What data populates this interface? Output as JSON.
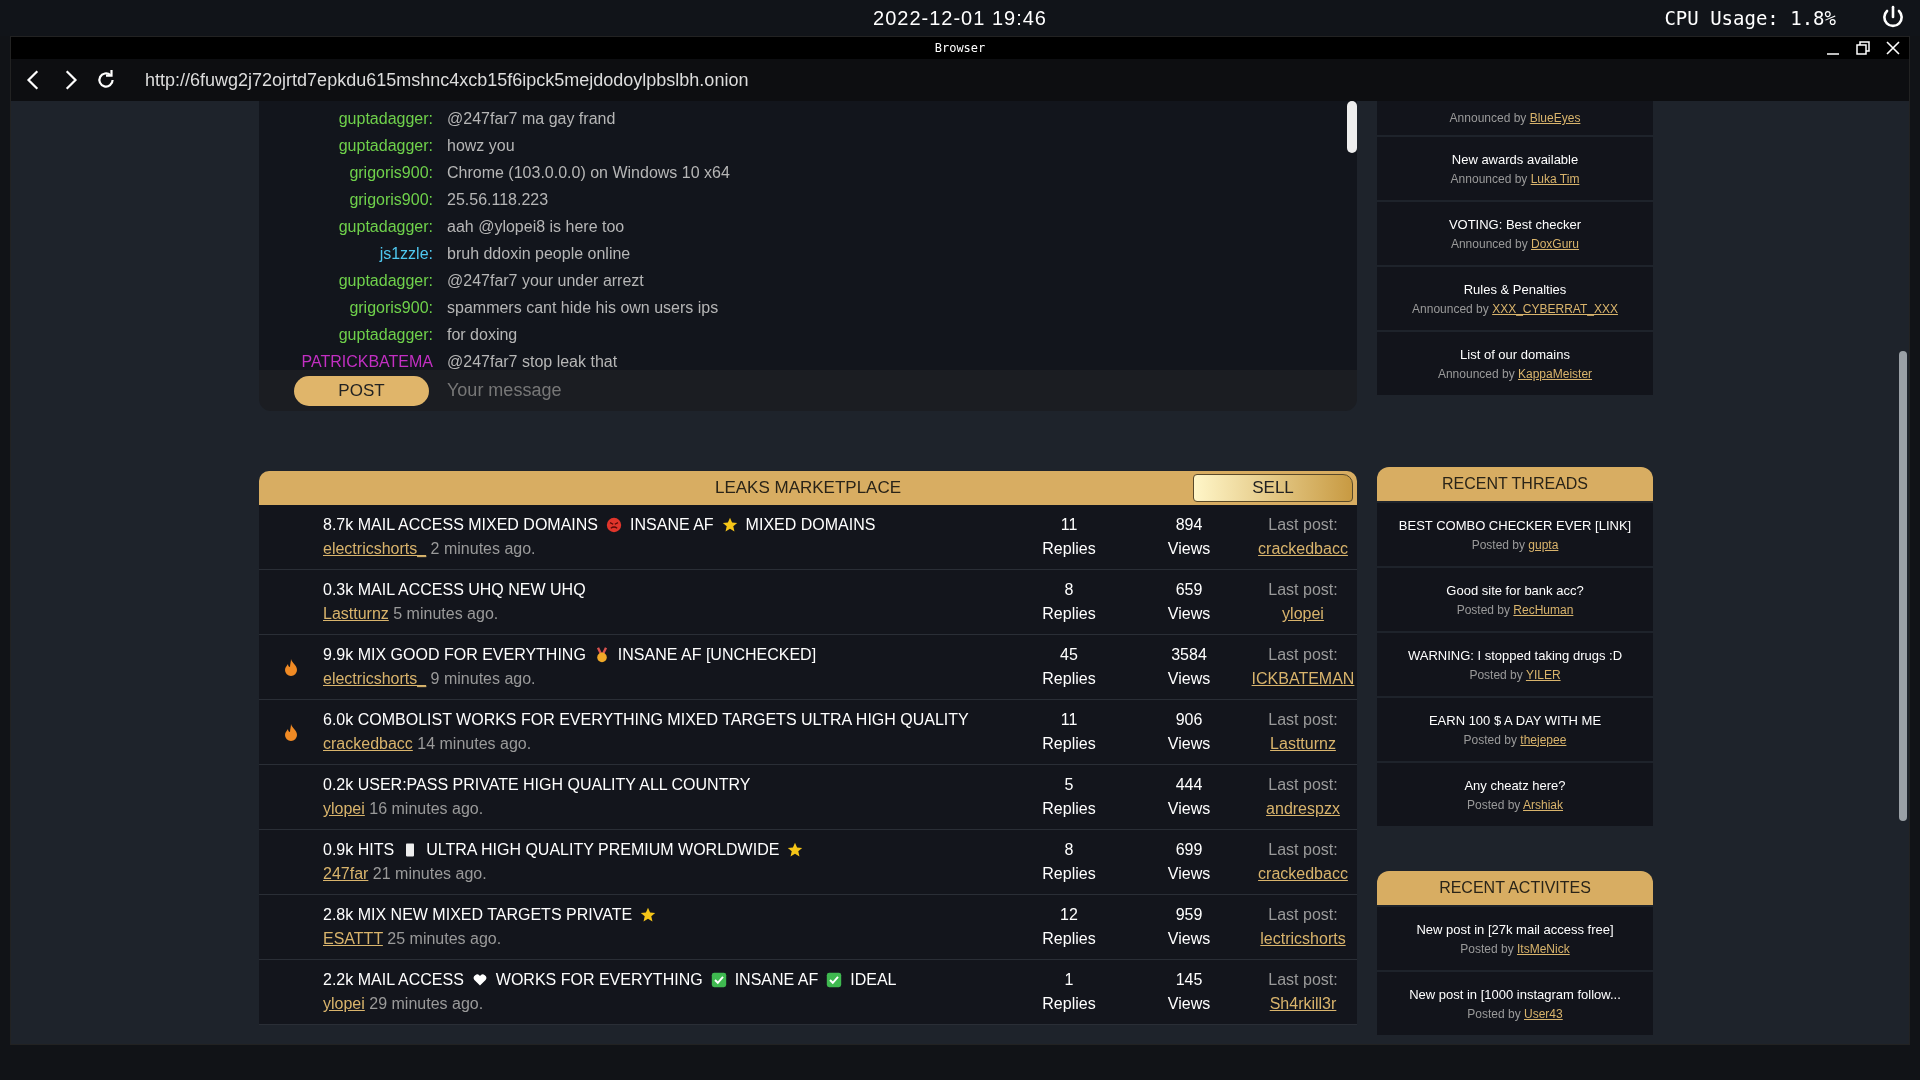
{
  "topbar": {
    "datetime": "2022-12-01 19:46",
    "cpu": "CPU Usage: 1.8%"
  },
  "window": {
    "title": "Browser",
    "url": "http://6fuwg2j72ojrtd7epkdu615mshnc4xcb15f6ipck5mejdodoylpbslbh.onion"
  },
  "chat": {
    "messages": [
      {
        "user": "guptadagger:",
        "color": "#6fd14b",
        "text": "@247far7 ma gay frand"
      },
      {
        "user": "guptadagger:",
        "color": "#6fd14b",
        "text": "howz you"
      },
      {
        "user": "grigoris900:",
        "color": "#6fd14b",
        "text": "Chrome (103.0.0.0) on Windows 10 x64"
      },
      {
        "user": "grigoris900:",
        "color": "#6fd14b",
        "text": "25.56.118.223"
      },
      {
        "user": "guptadagger:",
        "color": "#6fd14b",
        "text": "aah @ylopei8 is here too"
      },
      {
        "user": "js1zzle:",
        "color": "#4fc8f0",
        "text": "bruh ddoxin people online"
      },
      {
        "user": "guptadagger:",
        "color": "#6fd14b",
        "text": "@247far7 your under arrezt"
      },
      {
        "user": "grigoris900:",
        "color": "#6fd14b",
        "text": "spammers cant hide his own users ips"
      },
      {
        "user": "guptadagger:",
        "color": "#6fd14b",
        "text": "for doxing"
      },
      {
        "user": "PATRICKBATEMA",
        "color": "#c22fc2",
        "text": "@247far7 stop leak that"
      }
    ],
    "post_button": "POST",
    "placeholder": "Your message"
  },
  "marketplace": {
    "title": "LEAKS MARKETPLACE",
    "sell_button": "SELL",
    "threads": [
      {
        "hot": false,
        "parts": [
          {
            "kind": "text",
            "text": "8.7k MAIL ACCESS MIXED DOMAINS"
          },
          {
            "kind": "angry"
          },
          {
            "kind": "text",
            "text": "INSANE AF"
          },
          {
            "kind": "star"
          },
          {
            "kind": "text",
            "text": "MIXED DOMAINS"
          }
        ],
        "author": "electricshorts_",
        "time": "2 minutes ago.",
        "replies": "11",
        "replies_label": "Replies",
        "views": "894",
        "views_label": "Views",
        "last_label": "Last post:",
        "last_user": "crackedbacc"
      },
      {
        "hot": false,
        "parts": [
          {
            "kind": "text",
            "text": "0.3k MAIL ACCESS UHQ NEW UHQ"
          }
        ],
        "author": "Lastturnz",
        "time": "5 minutes ago.",
        "replies": "8",
        "replies_label": "Replies",
        "views": "659",
        "views_label": "Views",
        "last_label": "Last post:",
        "last_user": "ylopei"
      },
      {
        "hot": true,
        "parts": [
          {
            "kind": "text",
            "text": "9.9k MIX GOOD FOR EVERYTHING"
          },
          {
            "kind": "medal"
          },
          {
            "kind": "text",
            "text": "INSANE AF [UNCHECKED]"
          }
        ],
        "author": "electricshorts_",
        "time": "9 minutes ago.",
        "replies": "45",
        "replies_label": "Replies",
        "views": "3584",
        "views_label": "Views",
        "last_label": "Last post:",
        "last_user": "ICKBATEMAN"
      },
      {
        "hot": true,
        "parts": [
          {
            "kind": "text",
            "text": "6.0k COMBOLIST WORKS FOR EVERYTHING MIXED TARGETS ULTRA HIGH QUALITY"
          }
        ],
        "author": "crackedbacc",
        "time": "14 minutes ago.",
        "replies": "11",
        "replies_label": "Replies",
        "views": "906",
        "views_label": "Views",
        "last_label": "Last post:",
        "last_user": "Lastturnz"
      },
      {
        "hot": false,
        "parts": [
          {
            "kind": "text",
            "text": "0.2k USER:PASS PRIVATE HIGH QUALITY ALL COUNTRY"
          }
        ],
        "author": "ylopei",
        "time": "16 minutes ago.",
        "replies": "5",
        "replies_label": "Replies",
        "views": "444",
        "views_label": "Views",
        "last_label": "Last post:",
        "last_user": "andrespzx"
      },
      {
        "hot": false,
        "parts": [
          {
            "kind": "text",
            "text": "0.9k HITS"
          },
          {
            "kind": "scroll"
          },
          {
            "kind": "text",
            "text": "ULTRA HIGH QUALITY PREMIUM WORLDWIDE"
          },
          {
            "kind": "star"
          }
        ],
        "author": "247far",
        "time": "21 minutes ago.",
        "replies": "8",
        "replies_label": "Replies",
        "views": "699",
        "views_label": "Views",
        "last_label": "Last post:",
        "last_user": "crackedbacc"
      },
      {
        "hot": false,
        "parts": [
          {
            "kind": "text",
            "text": "2.8k MIX NEW MIXED TARGETS PRIVATE"
          },
          {
            "kind": "star"
          }
        ],
        "author": "ESATTT",
        "time": "25 minutes ago.",
        "replies": "12",
        "replies_label": "Replies",
        "views": "959",
        "views_label": "Views",
        "last_label": "Last post:",
        "last_user": "lectricshorts"
      },
      {
        "hot": false,
        "parts": [
          {
            "kind": "text",
            "text": "2.2k MAIL ACCESS"
          },
          {
            "kind": "heart"
          },
          {
            "kind": "text",
            "text": "WORKS FOR EVERYTHING"
          },
          {
            "kind": "check"
          },
          {
            "kind": "text",
            "text": "INSANE AF"
          },
          {
            "kind": "check"
          },
          {
            "kind": "text",
            "text": "IDEAL"
          }
        ],
        "author": "ylopei",
        "time": "29 minutes ago.",
        "replies": "1",
        "replies_label": "Replies",
        "views": "145",
        "views_label": "Views",
        "last_label": "Last post:",
        "last_user": "Sh4rkill3r"
      }
    ]
  },
  "announcements": [
    {
      "prefix": "Announced by",
      "user": "BlueEyes"
    },
    {
      "title": "New awards available",
      "prefix": "Announced by",
      "user": "Luka Tim"
    },
    {
      "title": "VOTING: Best checker",
      "prefix": "Announced by",
      "user": "DoxGuru"
    },
    {
      "title": "Rules & Penalties",
      "prefix": "Announced by",
      "user": "XXX_CYBERRAT_XXX"
    },
    {
      "title": "List of our domains",
      "prefix": "Announced by",
      "user": "KappaMeister"
    }
  ],
  "recent_threads": {
    "title": "RECENT THREADS",
    "items": [
      {
        "title": "BEST COMBO CHECKER EVER [LINK]",
        "prefix": "Posted by",
        "user": "gupta"
      },
      {
        "title": "Good site for bank acc?",
        "prefix": "Posted by",
        "user": "RecHuman"
      },
      {
        "title": "WARNING: I stopped taking drugs :D",
        "prefix": "Posted by",
        "user": "YILER"
      },
      {
        "title": "EARN 100 $ A DAY WITH ME",
        "prefix": "Posted by",
        "user": "thejepee"
      },
      {
        "title": "Any cheatz here?",
        "prefix": "Posted by",
        "user": "Arshiak"
      }
    ]
  },
  "recent_activities": {
    "title": "RECENT ACTIVITES",
    "items": [
      {
        "title": "New post in [27k mail access free]",
        "prefix": "Posted by",
        "user": "ItsMeNick"
      },
      {
        "title": "New post in [1000 instagram follow...",
        "prefix": "Posted by",
        "user": "User43"
      }
    ]
  }
}
